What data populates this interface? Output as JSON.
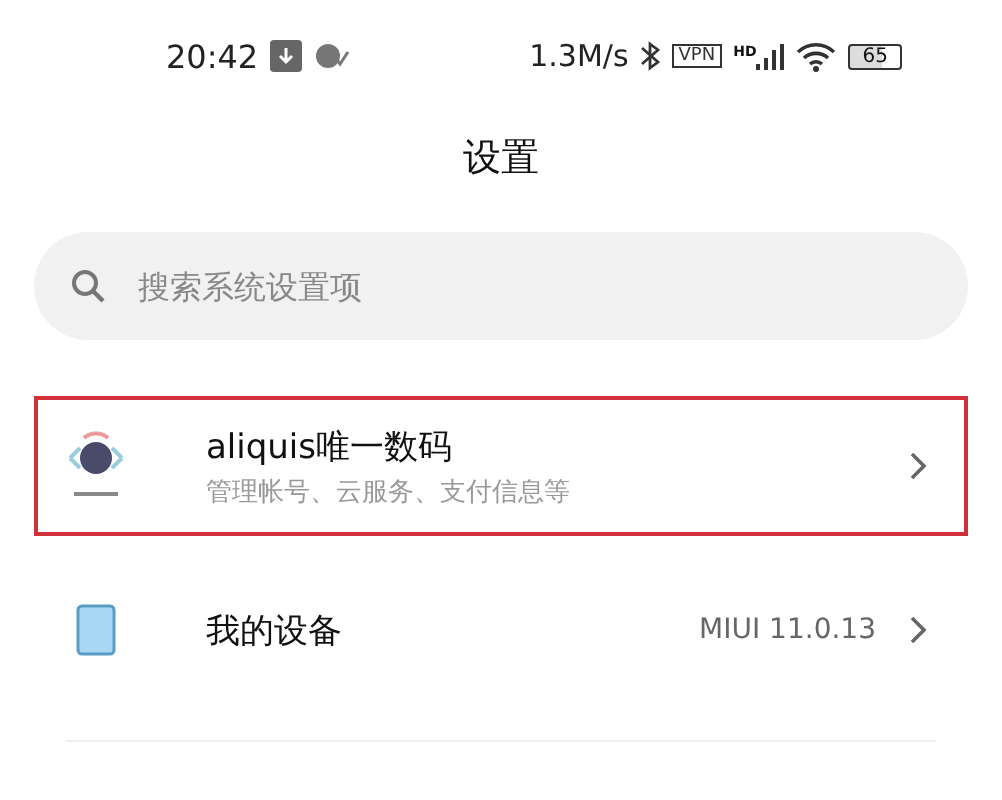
{
  "status_bar": {
    "time": "20:42",
    "speed": "1.3M/s",
    "vpn": "VPN",
    "signal_tag": "HD",
    "battery": "65"
  },
  "title": "设置",
  "search": {
    "placeholder": "搜索系统设置项"
  },
  "items": [
    {
      "kind": "account",
      "title": "aliquis唯一数码",
      "subtitle": "管理帐号、云服务、支付信息等",
      "highlighted": true
    },
    {
      "kind": "device",
      "title": "我的设备",
      "value": "MIUI 11.0.13",
      "highlighted": false
    }
  ]
}
